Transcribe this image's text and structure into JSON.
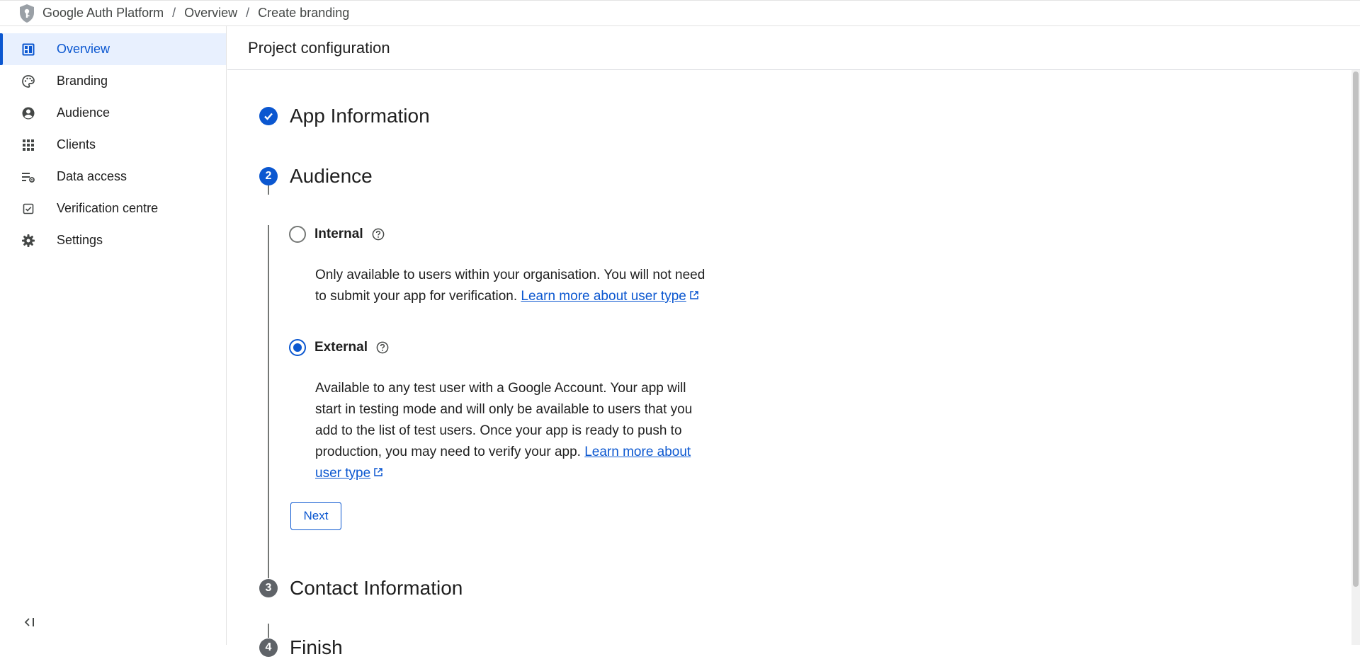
{
  "breadcrumb": {
    "items": [
      "Google Auth Platform",
      "Overview",
      "Create branding"
    ],
    "separator": "/"
  },
  "sidebar": {
    "items": [
      {
        "label": "Overview",
        "icon": "dashboard-icon",
        "active": true
      },
      {
        "label": "Branding",
        "icon": "palette-icon",
        "active": false
      },
      {
        "label": "Audience",
        "icon": "account-circle-icon",
        "active": false
      },
      {
        "label": "Clients",
        "icon": "apps-grid-icon",
        "active": false
      },
      {
        "label": "Data access",
        "icon": "list-settings-icon",
        "active": false
      },
      {
        "label": "Verification centre",
        "icon": "check-box-icon",
        "active": false
      },
      {
        "label": "Settings",
        "icon": "gear-icon",
        "active": false
      }
    ],
    "collapse_icon": "collapse-sidebar-icon"
  },
  "main": {
    "title": "Project configuration",
    "steps": [
      {
        "badge": "",
        "title": "App Information",
        "state": "done"
      },
      {
        "badge": "2",
        "title": "Audience",
        "state": "current"
      },
      {
        "badge": "3",
        "title": "Contact Information",
        "state": "pending"
      },
      {
        "badge": "4",
        "title": "Finish",
        "state": "pending"
      }
    ],
    "audience": {
      "internal": {
        "label": "Internal",
        "selected": false,
        "description": "Only available to users within your organisation. You will not need to submit your app for verification.",
        "link": "Learn more about user type"
      },
      "external": {
        "label": "External",
        "selected": true,
        "description": "Available to any test user with a Google Account. Your app will start in testing mode and will only be available to users that you add to the list of test users. Once your app is ready to push to production, you may need to verify your app.",
        "link": "Learn more about user type"
      },
      "next_label": "Next"
    }
  },
  "colors": {
    "accent": "#0b57d0",
    "active_bg": "#e8f0fe",
    "pending_badge": "#5f6368",
    "line": "#747775"
  }
}
